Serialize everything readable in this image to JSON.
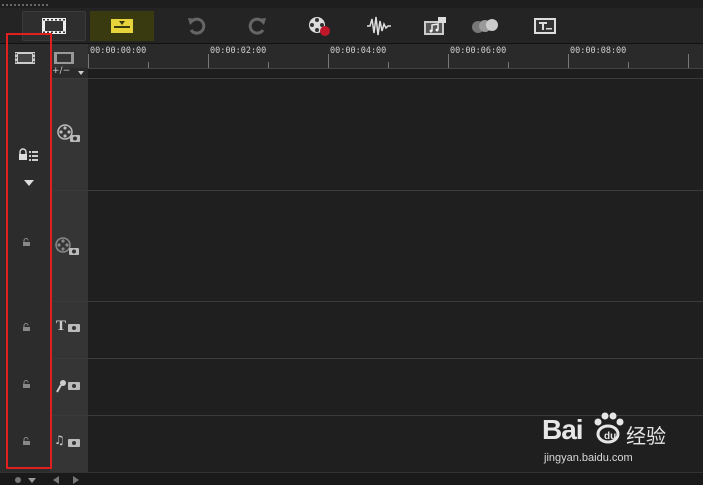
{
  "toolbar": {
    "buttons": [
      {
        "name": "timeline-view",
        "icon": "film-strip-icon",
        "active": true
      },
      {
        "name": "storyboard-view",
        "icon": "storyboard-icon",
        "accent": "#e8d43a"
      },
      {
        "name": "undo",
        "icon": "undo-icon"
      },
      {
        "name": "redo",
        "icon": "redo-icon"
      },
      {
        "name": "record-capture",
        "icon": "record-capture-icon"
      },
      {
        "name": "sound-mixer",
        "icon": "sound-wave-icon"
      },
      {
        "name": "auto-music",
        "icon": "auto-music-icon"
      },
      {
        "name": "motion-tracking",
        "icon": "motion-tracking-icon"
      },
      {
        "name": "subtitle-editor",
        "icon": "subtitle-editor-icon"
      }
    ]
  },
  "ruler": {
    "timecodes": [
      "00:00:00:00",
      "00:00:02:00",
      "00:00:04:00",
      "00:00:06:00",
      "00:00:08:00"
    ]
  },
  "track_header": {
    "add_remove_label": "+/−"
  },
  "tracks": [
    {
      "name": "video-track",
      "icon": "video-track-icon"
    },
    {
      "name": "overlay-track",
      "icon": "overlay-track-icon"
    },
    {
      "name": "title-track",
      "icon": "title-track-icon",
      "glyph": "T"
    },
    {
      "name": "voice-track",
      "icon": "voice-track-icon"
    },
    {
      "name": "music-track",
      "icon": "music-track-icon",
      "glyph": "♫"
    }
  ],
  "watermark": {
    "brand_left": "Bai",
    "brand_right": "经验",
    "url": "jingyan.baidu.com"
  },
  "colors": {
    "highlight_box": "#e0201e",
    "background": "#1e1e1e",
    "track_bg": "#1f1f1f"
  }
}
